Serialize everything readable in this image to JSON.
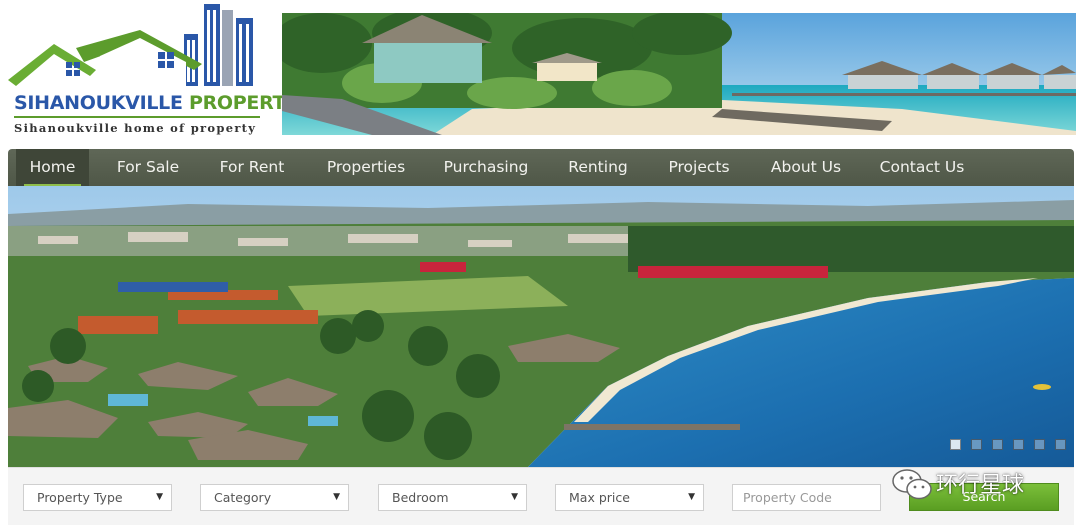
{
  "brand": {
    "name_part1": "SIHANOUKVILLE",
    "name_part2": "PROPERTY",
    "tagline": "Sihanoukville home of property",
    "colors": {
      "blue": "#2a57a8",
      "green": "#5c9c2c"
    }
  },
  "nav": {
    "items": [
      {
        "label": "Home",
        "active": true
      },
      {
        "label": "For Sale"
      },
      {
        "label": "For Rent"
      },
      {
        "label": "Properties"
      },
      {
        "label": "Purchasing"
      },
      {
        "label": "Renting"
      },
      {
        "label": "Projects"
      },
      {
        "label": "About Us"
      },
      {
        "label": "Contact Us"
      }
    ],
    "bar_color": "#555d4d"
  },
  "slider": {
    "slide_count": 6,
    "active_slide": 1
  },
  "search": {
    "property_type": "Property Type",
    "category": "Category",
    "bedroom": "Bedroom",
    "max_price": "Max price",
    "property_code_placeholder": "Property Code",
    "button_label": "Search",
    "button_color": "#6cb030"
  },
  "watermark": {
    "text": "环行星球",
    "icon": "wechat-icon"
  }
}
